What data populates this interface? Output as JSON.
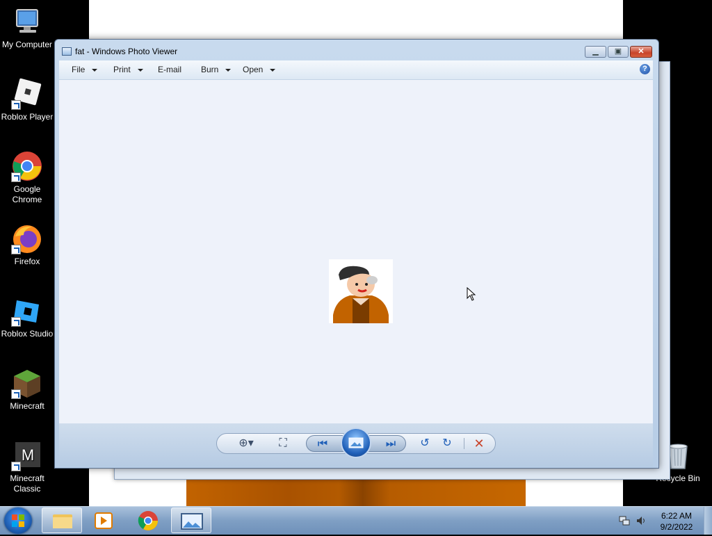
{
  "desktop": {
    "icons": [
      {
        "label": "My Computer"
      },
      {
        "label": "Roblox Player"
      },
      {
        "label": "Google Chrome"
      },
      {
        "label": "Firefox"
      },
      {
        "label": "Roblox Studio"
      },
      {
        "label": "Minecraft"
      },
      {
        "label": "Minecraft Classic"
      },
      {
        "label": "Recycle Bin"
      }
    ]
  },
  "window": {
    "title": "fat - Windows Photo Viewer",
    "menu": [
      {
        "label": "File"
      },
      {
        "label": "Print"
      },
      {
        "label": "E-mail"
      },
      {
        "label": "Burn"
      },
      {
        "label": "Open"
      }
    ],
    "help_label": "?"
  },
  "taskbar": {
    "time": "6:22 AM",
    "date": "9/2/2022"
  },
  "colors": {
    "viewer_bg": "#eef2fa",
    "close_red": "#c8432a",
    "accent_blue": "#1f5fb8"
  }
}
